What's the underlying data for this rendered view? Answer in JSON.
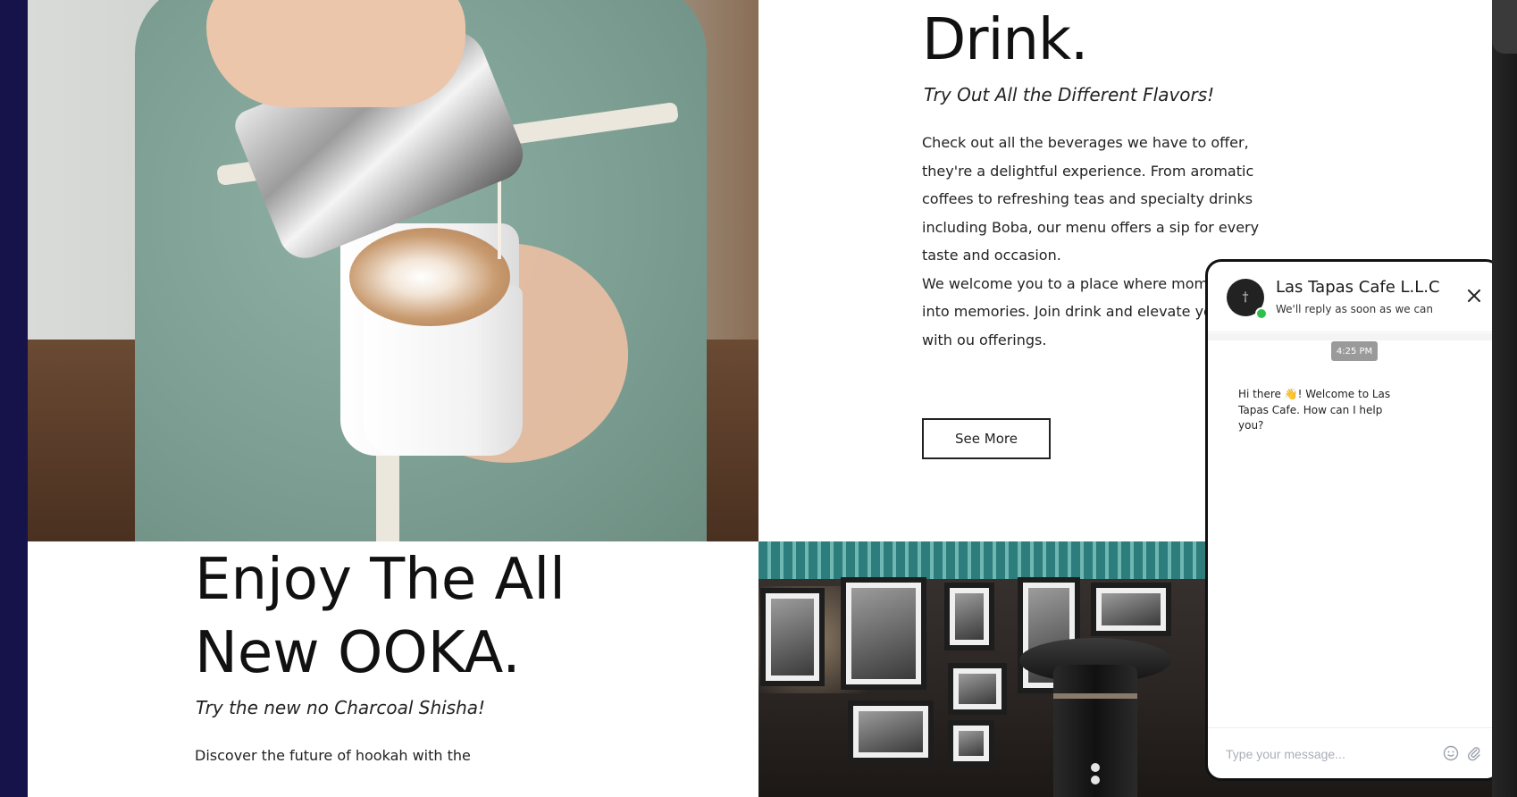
{
  "drink": {
    "title": "Drink.",
    "subtitle": "Try Out All the Different Flavors!",
    "paragraph_1": "Check out all the beverages we have to offer, they're a delightful experience. From aromatic coffees to refreshing teas and specialty drinks including Boba, our menu offers a sip for every taste and occasion.",
    "paragraph_2": "We welcome you to a place where moments turn into memories. Join drink and elevate your day with ou offerings.",
    "button_label": "See More"
  },
  "ooka": {
    "title_line_1": "Enjoy The All",
    "title_line_2": "New OOKA.",
    "subtitle": "Try the new no Charcoal Shisha!",
    "body": "Discover the future of hookah with the"
  },
  "chat": {
    "name": "Las Tapas Cafe L.L.C",
    "status": "We'll reply as soon as we can",
    "avatar_text": "†",
    "timestamp": "4:25 PM",
    "message": "Hi there 👋! Welcome to Las Tapas Cafe. How can I help you?",
    "input_placeholder": "Type your message...",
    "online_color": "#2fbf4a"
  },
  "icons": {
    "close": "close-icon",
    "emoji": "smiley-icon",
    "attach": "paperclip-icon"
  },
  "colors": {
    "outer_background": "#16124a",
    "page_background": "#ffffff",
    "text": "#222222"
  }
}
